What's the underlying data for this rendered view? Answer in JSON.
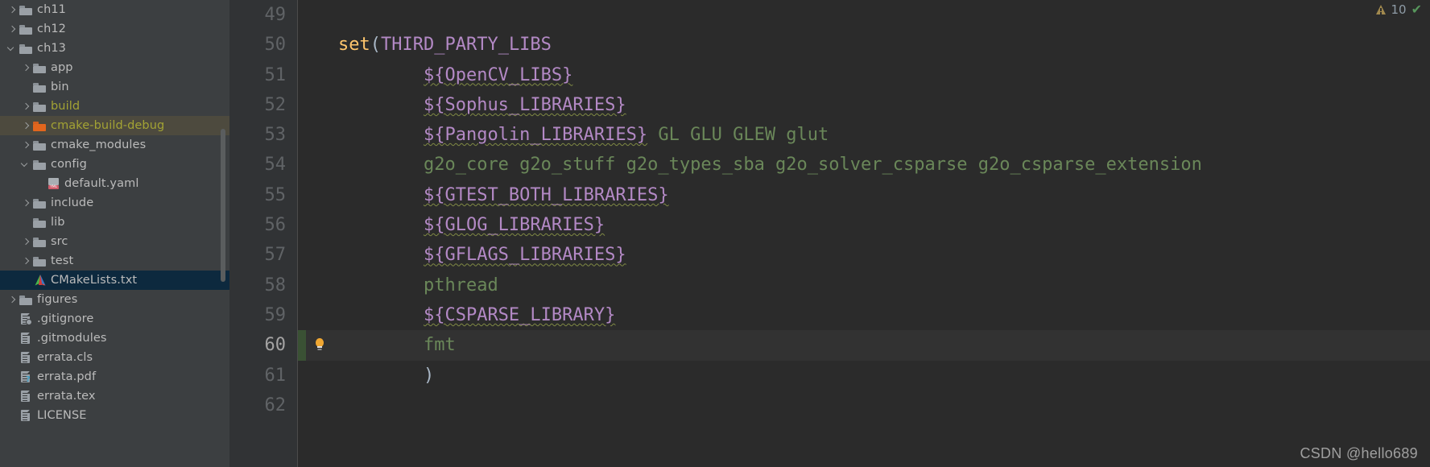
{
  "sidebar": {
    "name": "project-file-tree",
    "scrollbar_visible": true,
    "items": [
      {
        "label": "ch11",
        "indent": 0,
        "arrow": "right",
        "icon": "folder-icon",
        "style": "normal"
      },
      {
        "label": "ch12",
        "indent": 0,
        "arrow": "right",
        "icon": "folder-icon",
        "style": "normal"
      },
      {
        "label": "ch13",
        "indent": 0,
        "arrow": "down",
        "icon": "folder-icon",
        "style": "normal"
      },
      {
        "label": "app",
        "indent": 1,
        "arrow": "right",
        "icon": "folder-icon",
        "style": "normal"
      },
      {
        "label": "bin",
        "indent": 1,
        "arrow": "none",
        "icon": "folder-icon",
        "style": "normal"
      },
      {
        "label": "build",
        "indent": 1,
        "arrow": "right",
        "icon": "folder-icon",
        "style": "olive"
      },
      {
        "label": "cmake-build-debug",
        "indent": 1,
        "arrow": "right",
        "icon": "folder-icon-orange",
        "style": "olive-highlight"
      },
      {
        "label": "cmake_modules",
        "indent": 1,
        "arrow": "right",
        "icon": "folder-icon",
        "style": "normal"
      },
      {
        "label": "config",
        "indent": 1,
        "arrow": "down",
        "icon": "folder-icon",
        "style": "normal"
      },
      {
        "label": "default.yaml",
        "indent": 2,
        "arrow": "none",
        "icon": "yaml-file-icon",
        "style": "normal"
      },
      {
        "label": "include",
        "indent": 1,
        "arrow": "right",
        "icon": "folder-icon",
        "style": "normal"
      },
      {
        "label": "lib",
        "indent": 1,
        "arrow": "none",
        "icon": "folder-icon",
        "style": "normal"
      },
      {
        "label": "src",
        "indent": 1,
        "arrow": "right",
        "icon": "folder-icon",
        "style": "normal"
      },
      {
        "label": "test",
        "indent": 1,
        "arrow": "right",
        "icon": "folder-icon",
        "style": "normal"
      },
      {
        "label": "CMakeLists.txt",
        "indent": 1,
        "arrow": "none",
        "icon": "cmake-file-icon",
        "style": "selected"
      },
      {
        "label": "figures",
        "indent": 0,
        "arrow": "right",
        "icon": "folder-icon",
        "style": "normal"
      },
      {
        "label": ".gitignore",
        "indent": 0,
        "arrow": "none",
        "icon": "file-icon-ignored",
        "style": "normal"
      },
      {
        "label": ".gitmodules",
        "indent": 0,
        "arrow": "none",
        "icon": "file-icon",
        "style": "normal"
      },
      {
        "label": "errata.cls",
        "indent": 0,
        "arrow": "none",
        "icon": "file-icon",
        "style": "normal"
      },
      {
        "label": "errata.pdf",
        "indent": 0,
        "arrow": "none",
        "icon": "file-icon-unknown",
        "style": "normal"
      },
      {
        "label": "errata.tex",
        "indent": 0,
        "arrow": "none",
        "icon": "file-icon",
        "style": "normal"
      },
      {
        "label": "LICENSE",
        "indent": 0,
        "arrow": "none",
        "icon": "file-icon",
        "style": "normal"
      }
    ]
  },
  "editor": {
    "name": "cmakelists-editor",
    "language": "CMake",
    "first_line_number": 49,
    "current_line_number": 60,
    "lines": [
      {
        "num": "49",
        "indent": 0,
        "current": false,
        "bulb": false,
        "changed": false,
        "tokens": []
      },
      {
        "num": "50",
        "indent": 0,
        "current": false,
        "bulb": false,
        "changed": false,
        "tokens": [
          {
            "t": "set",
            "c": "fn",
            "squiggle": false
          },
          {
            "t": "(",
            "c": "paren",
            "squiggle": false
          },
          {
            "t": "THIRD_PARTY_LIBS",
            "c": "var",
            "squiggle": false
          }
        ]
      },
      {
        "num": "51",
        "indent": 8,
        "current": false,
        "bulb": false,
        "changed": false,
        "tokens": [
          {
            "t": "${OpenCV_LIBS}",
            "c": "var",
            "squiggle": true
          }
        ]
      },
      {
        "num": "52",
        "indent": 8,
        "current": false,
        "bulb": false,
        "changed": false,
        "tokens": [
          {
            "t": "${Sophus_LIBRARIES}",
            "c": "var",
            "squiggle": true
          }
        ]
      },
      {
        "num": "53",
        "indent": 8,
        "current": false,
        "bulb": false,
        "changed": false,
        "tokens": [
          {
            "t": "${Pangolin_LIBRARIES}",
            "c": "var",
            "squiggle": true
          },
          {
            "t": " GL GLU GLEW glut",
            "c": "plain",
            "squiggle": false
          }
        ]
      },
      {
        "num": "54",
        "indent": 8,
        "current": false,
        "bulb": false,
        "changed": false,
        "tokens": [
          {
            "t": "g2o_core g2o_stuff g2o_types_sba g2o_solver_csparse g2o_csparse_extension",
            "c": "plain",
            "squiggle": false
          }
        ]
      },
      {
        "num": "55",
        "indent": 8,
        "current": false,
        "bulb": false,
        "changed": false,
        "tokens": [
          {
            "t": "${GTEST_BOTH_LIBRARIES}",
            "c": "var",
            "squiggle": true
          }
        ]
      },
      {
        "num": "56",
        "indent": 8,
        "current": false,
        "bulb": false,
        "changed": false,
        "tokens": [
          {
            "t": "${GLOG_LIBRARIES}",
            "c": "var",
            "squiggle": true
          }
        ]
      },
      {
        "num": "57",
        "indent": 8,
        "current": false,
        "bulb": false,
        "changed": false,
        "tokens": [
          {
            "t": "${GFLAGS_LIBRARIES}",
            "c": "var",
            "squiggle": true
          }
        ]
      },
      {
        "num": "58",
        "indent": 8,
        "current": false,
        "bulb": false,
        "changed": false,
        "tokens": [
          {
            "t": "pthread",
            "c": "plain",
            "squiggle": false
          }
        ]
      },
      {
        "num": "59",
        "indent": 8,
        "current": false,
        "bulb": false,
        "changed": false,
        "tokens": [
          {
            "t": "${CSPARSE_LIBRARY}",
            "c": "var",
            "squiggle": true
          }
        ]
      },
      {
        "num": "60",
        "indent": 8,
        "current": true,
        "bulb": true,
        "changed": true,
        "tokens": [
          {
            "t": "fmt",
            "c": "plain",
            "squiggle": false
          }
        ]
      },
      {
        "num": "61",
        "indent": 8,
        "current": false,
        "bulb": false,
        "changed": false,
        "tokens": [
          {
            "t": ")",
            "c": "paren",
            "squiggle": false
          }
        ]
      },
      {
        "num": "62",
        "indent": 0,
        "current": false,
        "bulb": false,
        "changed": false,
        "tokens": []
      }
    ]
  },
  "inspection_widget": {
    "warning_icon": "warning-triangle-icon",
    "warning_count": "10",
    "status_icon": "checkmark-ok-icon",
    "status_glyph": "✔"
  },
  "watermark": {
    "text": "CSDN @hello689"
  },
  "colors": {
    "sidebar_bg": "#3c3f41",
    "gutter_bg": "#313335",
    "editor_bg": "#2b2b2b",
    "current_line_bg": "#323232",
    "selection_bg": "#0d293e",
    "highlight_tan_bg": "#4d4a3e",
    "olive_text": "#a3a334",
    "label_text": "#bbbbbb",
    "keyword_orange": "#ffc66d",
    "variable_purple": "#b389c5",
    "string_green": "#6a8759",
    "line_number": "#606366",
    "changed_marker_green": "#3a5134",
    "bulb_amber": "#f0a732"
  }
}
